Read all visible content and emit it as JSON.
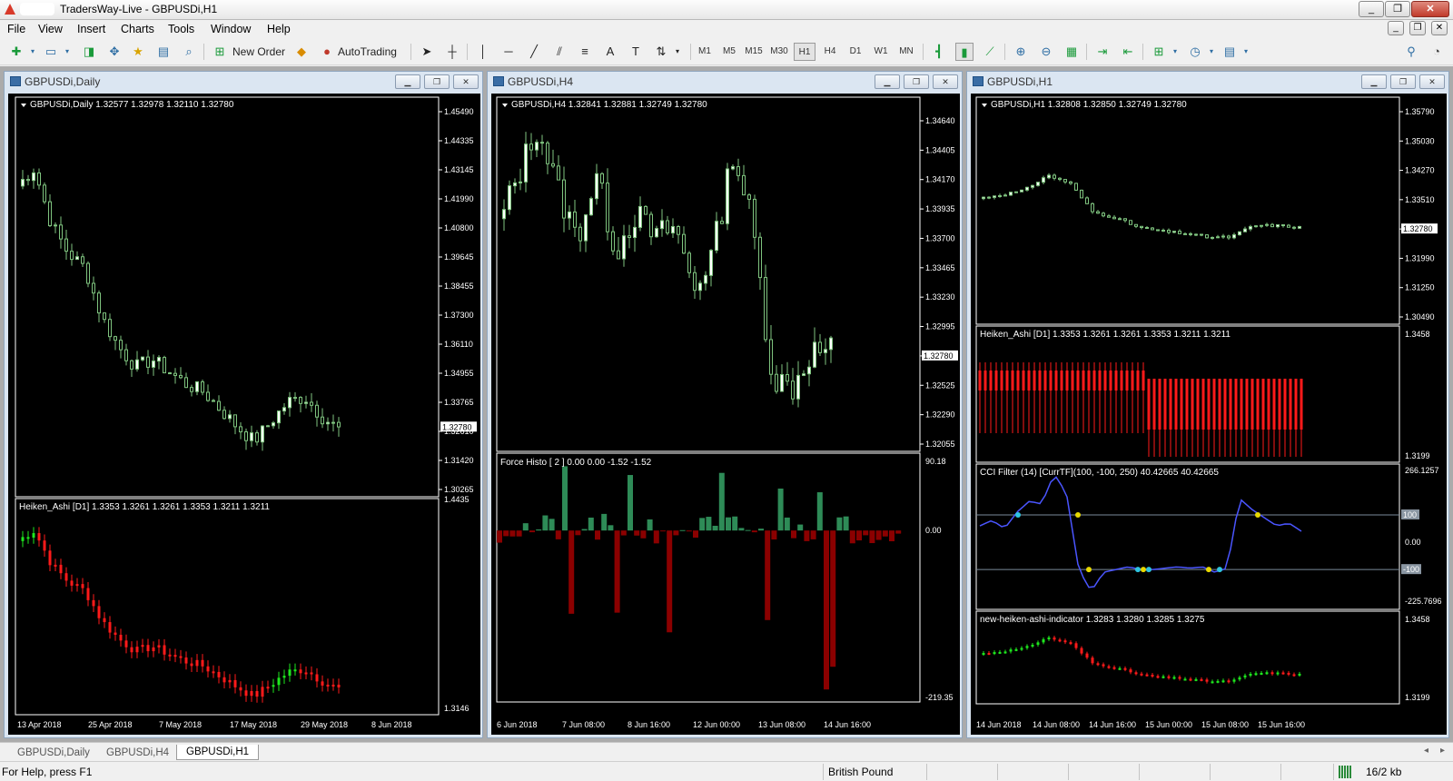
{
  "app": {
    "title": "TradersWay-Live - GBPUSDi,H1",
    "menu": [
      "File",
      "View",
      "Insert",
      "Charts",
      "Tools",
      "Window",
      "Help"
    ]
  },
  "toolbar": {
    "new_order": "New Order",
    "autotrading": "AutoTrading",
    "timeframes": [
      "M1",
      "M5",
      "M15",
      "M30",
      "H1",
      "H4",
      "D1",
      "W1",
      "MN"
    ],
    "active_timeframe": "H1"
  },
  "windows": [
    {
      "title": "GBPUSDi,Daily",
      "header": "GBPUSDi,Daily  1.32577 1.32978 1.32110 1.32780",
      "price_ticks": [
        "1.45490",
        "1.44335",
        "1.43145",
        "1.41990",
        "1.40800",
        "1.39645",
        "1.38455",
        "1.37300",
        "1.36110",
        "1.34955",
        "1.33765",
        "1.32610",
        "1.31420",
        "1.30265"
      ],
      "current_price": "1.32780",
      "sub_header": "Heiken_Ashi [D1]  1.3353 1.3261 1.3261 1.3353 1.3211 1.3211",
      "sub_ticks": [
        "1.4435",
        "1.3146"
      ],
      "date_labels": [
        "13 Apr 2018",
        "25 Apr 2018",
        "7 May 2018",
        "17 May 2018",
        "29 May 2018",
        "8 Jun 2018"
      ]
    },
    {
      "title": "GBPUSDi,H4",
      "header": "GBPUSDi,H4  1.32841 1.32881 1.32749 1.32780",
      "price_ticks": [
        "1.34640",
        "1.34405",
        "1.34170",
        "1.33935",
        "1.33700",
        "1.33465",
        "1.33230",
        "1.32995",
        "1.32780",
        "1.32525",
        "1.32290",
        "1.32055"
      ],
      "current_price": "1.32780",
      "sub_header": "Force Histo [ 2 ]  0.00 0.00 -1.52 -1.52",
      "sub_ticks": [
        "90.18",
        "0.00",
        "-219.35"
      ],
      "date_labels": [
        "6 Jun 2018",
        "7 Jun 08:00",
        "8 Jun 16:00",
        "12 Jun 00:00",
        "13 Jun 08:00",
        "14 Jun 16:00"
      ]
    },
    {
      "title": "GBPUSDi,H1",
      "header": "GBPUSDi,H1  1.32808 1.32850 1.32749 1.32780",
      "price_ticks": [
        "1.35790",
        "1.35030",
        "1.34270",
        "1.33510",
        "1.32780",
        "1.31990",
        "1.31250",
        "1.30490"
      ],
      "current_price": "1.32780",
      "sub1_header": "Heiken_Ashi [D1]  1.3353 1.3261 1.3261 1.3353 1.3211 1.3211",
      "sub1_ticks": [
        "1.3458",
        "1.3199"
      ],
      "sub2_header": "CCI Filter (14) [CurrTF](100, -100, 250) 40.42665 40.42665",
      "sub2_ticks": [
        "266.1257",
        "100",
        "0.00",
        "-100",
        "-225.7696"
      ],
      "sub3_header": "new-heiken-ashi-indicator  1.3283 1.3280 1.3285 1.3275",
      "sub3_ticks": [
        "1.3458",
        "1.3199"
      ],
      "date_labels": [
        "14 Jun 2018",
        "14 Jun 08:00",
        "14 Jun 16:00",
        "15 Jun 00:00",
        "15 Jun 08:00",
        "15 Jun 16:00"
      ]
    }
  ],
  "tabs": [
    "GBPUSDi,Daily",
    "GBPUSDi,H4",
    "GBPUSDi,H1"
  ],
  "active_tab": "GBPUSDi,H1",
  "status": {
    "help": "For Help, press F1",
    "symbol": "British Pound",
    "traffic": "16/2 kb"
  },
  "colors": {
    "bull_candle": "#ffffff",
    "bear_candle": "#000000",
    "candle_wick": "#7fc47f",
    "ha_bear": "#ff1a1a",
    "ha_bull": "#1ee81e",
    "force_pos": "#2e8b57",
    "force_neg": "#8b0000",
    "cci_line": "#4a55ff"
  }
}
